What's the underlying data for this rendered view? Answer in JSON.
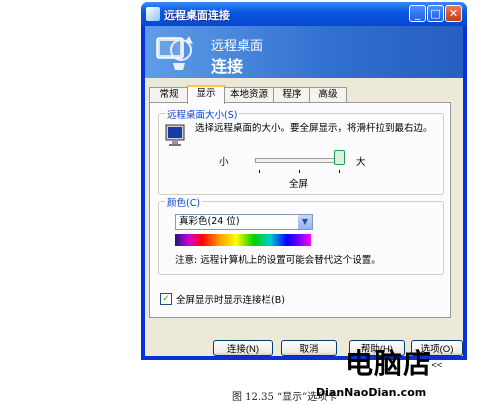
{
  "window": {
    "title": "远程桌面连接"
  },
  "banner": {
    "line1": "远程桌面",
    "line2": "连接"
  },
  "tabs": [
    {
      "label": "常规"
    },
    {
      "label": "显示"
    },
    {
      "label": "本地资源"
    },
    {
      "label": "程序"
    },
    {
      "label": "高级"
    }
  ],
  "active_tab": "显示",
  "size_group": {
    "label": "远程桌面大小(S)",
    "description": "选择远程桌面的大小。要全屏显示，将滑杆拉到最右边。",
    "small_label": "小",
    "large_label": "大",
    "value_label": "全屏",
    "slider_position": 1.0
  },
  "color_group": {
    "label": "颜色(C)",
    "selected": "真彩色(24 位)",
    "note": "注意: 远程计算机上的设置可能会替代这个设置。"
  },
  "fullscreen_bar": {
    "label": "全屏显示时显示连接栏(B)",
    "checked": true
  },
  "buttons": {
    "connect": "连接(N)",
    "cancel": "取消",
    "help": "帮助(H)",
    "options": "选项(O) <<"
  },
  "caption": "图 12.35    “显示”选项卡",
  "watermark": {
    "main": "电脑店",
    "sub": "DianNaoDian.com"
  },
  "colors": {
    "titlebar": "#0a5ae0",
    "accent_tab": "#ffc83c",
    "group_label": "#0046d5"
  }
}
